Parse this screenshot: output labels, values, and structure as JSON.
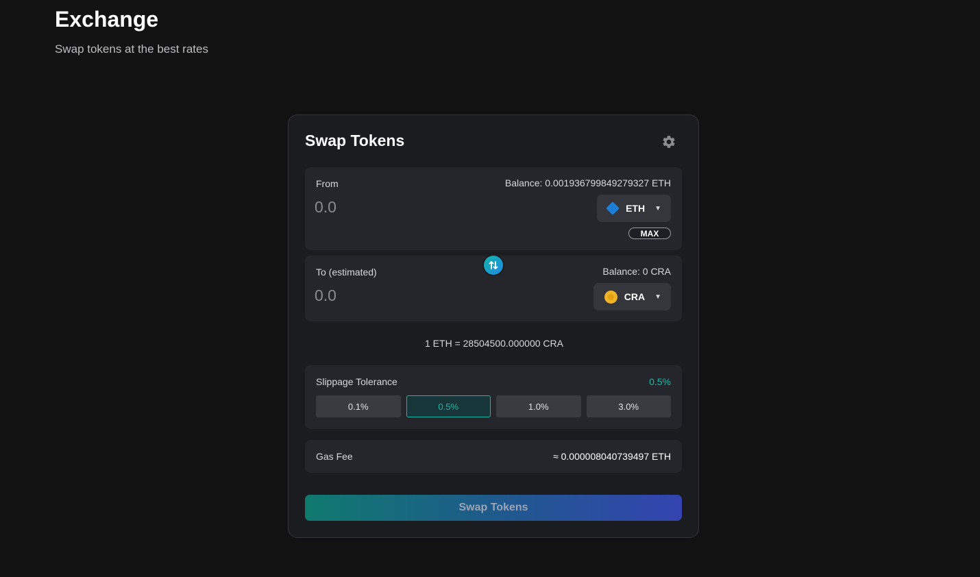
{
  "page": {
    "title": "Exchange",
    "subtitle": "Swap tokens at the best rates"
  },
  "card": {
    "title": "Swap Tokens",
    "settings_icon": "gear-icon"
  },
  "from": {
    "label": "From",
    "balance": "Balance: 0.001936799849279327 ETH",
    "amount_placeholder": "0.0",
    "amount_value": "",
    "token": {
      "symbol": "ETH",
      "icon": "eth-diamond-icon",
      "color": "#1c7ed6"
    },
    "max_label": "MAX"
  },
  "swap_direction_icon": "swap-arrows-icon",
  "to": {
    "label": "To (estimated)",
    "balance": "Balance: 0 CRA",
    "amount_placeholder": "0.0",
    "amount_value": "",
    "token": {
      "symbol": "CRA",
      "icon": "cra-coin-icon",
      "color": "#f0b429"
    }
  },
  "rate": "1 ETH = 28504500.000000 CRA",
  "slippage": {
    "label": "Slippage Tolerance",
    "current": "0.5%",
    "options": [
      "0.1%",
      "0.5%",
      "1.0%",
      "3.0%"
    ],
    "selected_index": 1
  },
  "gas": {
    "label": "Gas Fee",
    "value": "≈ 0.000008040739497 ETH"
  },
  "swap_button": "Swap Tokens",
  "colors": {
    "background": "#121212",
    "card": "#1b1c20",
    "accent": "#14b8a6",
    "button_gradient_start": "#0f7a6e",
    "button_gradient_end": "#3344b0"
  }
}
